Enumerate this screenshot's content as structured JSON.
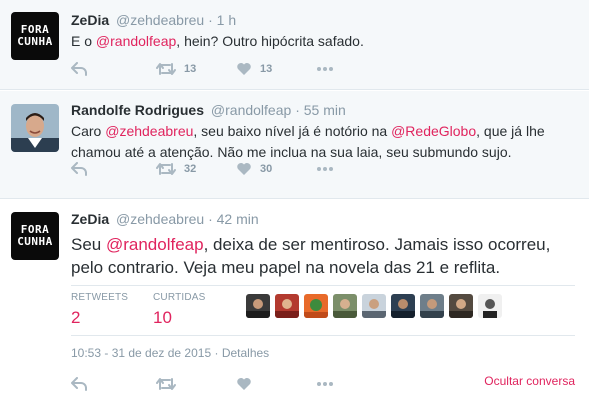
{
  "colors": {
    "accent": "#e0245e",
    "muted": "#8899a6",
    "text": "#292f33",
    "bg_context": "#f5f8fa"
  },
  "tweets": [
    {
      "avatar_text": [
        "FORA",
        "CUNHA"
      ],
      "name": "ZeDia",
      "handle": "@zehdeabreu",
      "time": "1 h",
      "text_before": "E o ",
      "mention": "@randolfeap",
      "text_after": ", hein? Outro hipócrita safado.",
      "retweets": "13",
      "likes": "13"
    },
    {
      "name": "Randolfe Rodrigues",
      "handle": "@randolfeap",
      "time": "55 min",
      "text_parts": [
        "Caro ",
        "@zehdeabreu",
        ", seu baixo nível já é notório na ",
        "@RedeGlobo",
        ", que já lhe chamou até a atenção. Não me inclua na sua laia, seu submundo sujo."
      ],
      "retweets": "32",
      "likes": "30"
    },
    {
      "avatar_text": [
        "FORA",
        "CUNHA"
      ],
      "name": "ZeDia",
      "handle": "@zehdeabreu",
      "time": "42 min",
      "text_before": "Seu ",
      "mention": "@randolfeap",
      "text_after": ", deixa de ser mentiroso. Jamais isso ocorreu, pelo contrario. Veja meu papel na novela das 21 e reflita.",
      "retweets_label": "RETWEETS",
      "retweets_value": "2",
      "likes_label": "CURTIDAS",
      "likes_value": "10",
      "timestamp": "10:53 - 31 de dez de 2015",
      "details": "Detalhes",
      "hide_conversation": "Ocultar conversa"
    }
  ],
  "separator": "·"
}
